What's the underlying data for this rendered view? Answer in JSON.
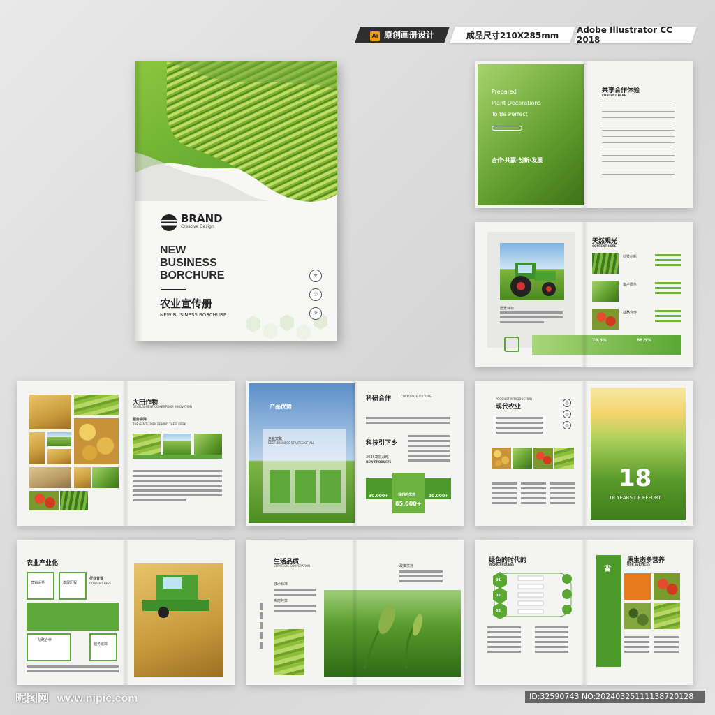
{
  "header": {
    "ai_logo": "Ai",
    "badge_original": "原创画册设计",
    "badge_size": "成品尺寸210X285mm",
    "badge_software": "Adobe Illustrator CC 2018"
  },
  "cover": {
    "brand": "BRAND",
    "brand_sub": "Creative Design",
    "title_line1": "NEW",
    "title_line2": "BUSINESS",
    "title_line3": "BORCHURE",
    "title_cn": "农业宣传册",
    "subtitle": "NEW BUSINESS BORCHURE",
    "icons": [
      "location-icon",
      "sprout-icon",
      "sun-icon"
    ]
  },
  "spread_contents": {
    "left_line1": "Prepared",
    "left_line2": "Plant Decorations",
    "left_line3": "To Be Perfect",
    "slogan": "合作·共赢·创新·发展",
    "toc_title": "共享合作体验",
    "toc_sub": "CONTENT HERE"
  },
  "spread_tractor": {
    "title": "天然观光",
    "sub": "CONTENT HERE",
    "items": [
      "科技创新",
      "客户服务",
      "战略合作"
    ],
    "stat1": "78.5%",
    "stat2": "88.5%",
    "caption": "愿景目标"
  },
  "spread_crops": {
    "title": "大田作物",
    "sub": "DEVELOPMENT COMES FROM INNOVATION",
    "label": "服务保障",
    "label_sub": "THE GENTLEMEN BEHIND THEIR DESK"
  },
  "spread_product": {
    "left_title": "产品优势",
    "culture": "企业文化",
    "culture_sub": "BEST BUSINESS STRATEG OF ALL",
    "right_title": "科研合作",
    "right_sub": "CORPORATE CULTURE",
    "tech": "科技引下乡",
    "year_plan": "2036发展战略",
    "new_products": "NEW PRODUCTS",
    "stat_left": "30.000+",
    "stat_mid": "85.000+",
    "stat_right": "30.000+",
    "mid_label": "我们的优势"
  },
  "spread_modern": {
    "title": "现代农业",
    "sub": "PRODUCT INTRODUCTION",
    "big_number": "18",
    "years": "18 YEARS OF EFFORT"
  },
  "spread_industry": {
    "title": "农业产业化",
    "boxes": [
      "营销适量",
      "发展历程",
      "战略合作",
      "服务追踪"
    ],
    "right_title": "行业背景",
    "right_sub": "CONTENT HERE"
  },
  "spread_life": {
    "title": "生活品质",
    "sub": "STRATEGIC COOPERATION",
    "items": [
      "技术标准",
      "实时共享"
    ],
    "policy": "政策扶持"
  },
  "spread_green": {
    "title": "绿色的时代的",
    "sub": "WORK PROCESS",
    "right_title": "原生态多营养",
    "right_sub": "OUR SERVICES",
    "steps": [
      "01",
      "02",
      "03"
    ]
  },
  "watermark": {
    "site_cn": "昵图网",
    "site_url": "www.nipic.com",
    "id_text": "ID:32590743 NO:20240325111138720128"
  }
}
